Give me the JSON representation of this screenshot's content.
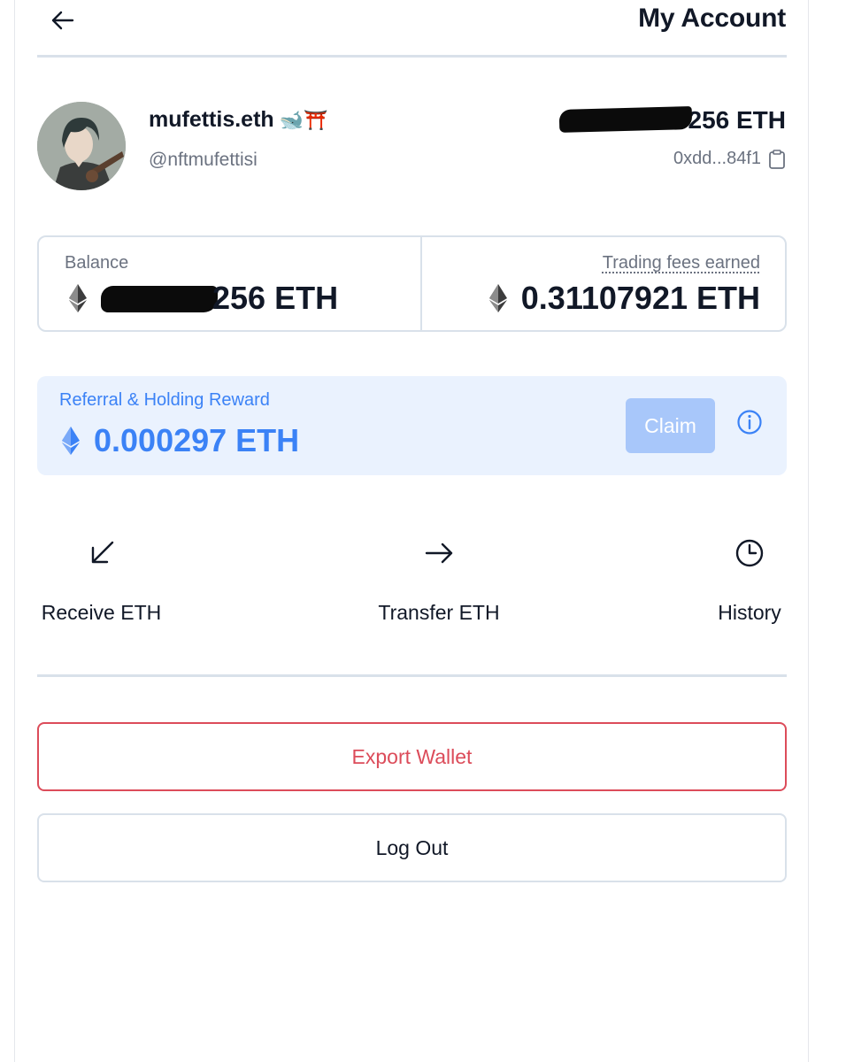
{
  "header": {
    "title": "My Account",
    "back_icon": "arrow-left-icon"
  },
  "profile": {
    "display_name": "mufettis.eth",
    "name_emojis": "🐋⛩️",
    "handle": "@nftmufettisi",
    "balance_visible_suffix": "256 ETH",
    "address": "0xdd...84f1",
    "copy_icon": "clipboard-icon"
  },
  "stats": {
    "balance_label": "Balance",
    "balance_visible_suffix": "256 ETH",
    "fees_label": "Trading fees earned",
    "fees_value": "0.31107921 ETH"
  },
  "reward": {
    "label": "Referral & Holding Reward",
    "value": "0.000297 ETH",
    "claim_label": "Claim",
    "info_icon": "info-icon"
  },
  "actions": [
    {
      "label": "Receive ETH",
      "icon": "arrow-down-left-icon"
    },
    {
      "label": "Transfer ETH",
      "icon": "arrow-right-icon"
    },
    {
      "label": "History",
      "icon": "clock-icon"
    }
  ],
  "buttons": {
    "export_label": "Export Wallet",
    "logout_label": "Log Out"
  },
  "colors": {
    "accent_blue": "#3b82f6",
    "reward_bg": "#eaf2fe",
    "claim_bg": "#a8c7fa",
    "danger": "#dc4c5a",
    "divider": "#d9e1ea"
  }
}
